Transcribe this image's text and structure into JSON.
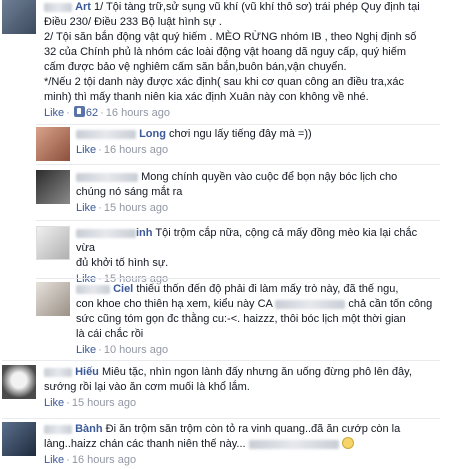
{
  "comments": [
    {
      "name": "Art",
      "lines": [
        "1/ Tội tàng trữ,sử sụng vũ khí (vũ khí thô sơ) trái phép Quy định tại",
        "Điều 230/ Điều 233 Bộ luật hình sự .",
        "2/ Tội săn bắn động vật quý hiếm . MÈO RỪNG nhóm IB , theo Nghị định số",
        "32 của Chính phủ là nhóm các loài động vật hoang dã nguy cấp, quý hiếm",
        "cấm được bảo vệ nghiêm cấm săn bắn,buôn bán,vận chuyển.",
        "*/Nếu 2 tội danh này được xác định( sau khi cơ quan công an điều tra,xác",
        "minh) thì mấy thanh niên kia xác định Xuân này con không về nhé."
      ],
      "like": "Like",
      "likes": "62",
      "time": "16 hours ago"
    },
    {
      "name": "Long",
      "lines": [
        "chơi ngu lấy tiếng đây mà =))"
      ],
      "like": "Like",
      "time": "16 hours ago"
    },
    {
      "name": "",
      "lines": [
        "Mong chính quyền vào cuộc để bọn nậy bóc lịch cho",
        "chúng nó sáng mắt ra"
      ],
      "like": "Like",
      "time": "15 hours ago"
    },
    {
      "name": "inh",
      "lines": [
        "Tội trộm cắp nữa, cộng cả mấy đồng mèo kia lại chắc vừa",
        "đủ khởi tố hình sự."
      ],
      "like": "Like",
      "time": "15 hours ago"
    },
    {
      "name": "Ciel",
      "lines": [
        "thiếu thốn đến độ phải đi làm mấy trò này, đã thế ngu,",
        "con khoe cho thiên hạ xem, kiểu này CA",
        "chả cần tốn công",
        "sức cũng tóm gọn đc thằng cu:-<. haizzz, thôi bóc lịch một thời gian",
        "là cái chắc rồi"
      ],
      "like": "Like",
      "time": "10 hours ago"
    },
    {
      "name": "Hiếu",
      "lines": [
        "Miêu tặc, nhìn ngon lành đấy nhưng ăn uống đừng phô lên đây,",
        "sướng rồi lại vào ăn cơm muối là khổ lắm."
      ],
      "like": "Like",
      "time": "15 hours ago"
    },
    {
      "name": "Bành",
      "lines": [
        "Đi ăn trộm săn trộm còn tỏ ra vinh quang..đã ăn cướp còn la",
        "làng..haizz chán các thanh niên thế này..."
      ],
      "like": "Like",
      "time": "16 hours ago"
    }
  ]
}
